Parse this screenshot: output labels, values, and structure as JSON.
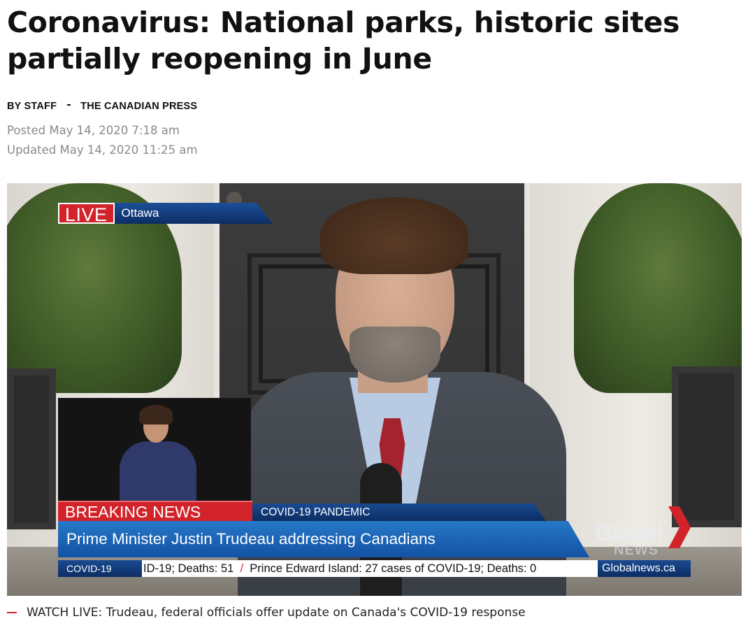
{
  "article": {
    "headline": "Coronavirus: National parks, historic sites partially reopening in June",
    "byline_author": "BY STAFF",
    "byline_source": "THE CANADIAN PRESS",
    "posted": "Posted May 14, 2020 7:18 am",
    "updated": "Updated May 14, 2020 11:25 am"
  },
  "video": {
    "live_label": "LIVE",
    "live_location": "Ottawa",
    "breaking_label": "BREAKING NEWS",
    "topic": "COVID-19 PANDEMIC",
    "headline": "Prime Minister Justin Trudeau addressing Canadians",
    "ticker_label": "COVID-19",
    "ticker_part1": "ID-19; Deaths: 51",
    "ticker_part2": "Prince Edward Island: 27 cases of COVID-19; Deaths: 0",
    "site": "Globalnews.ca",
    "logo_text": "Global",
    "logo_sub": "NEWS",
    "caption": "WATCH LIVE: Trudeau, federal officials offer update on Canada's COVID-19 response"
  },
  "colors": {
    "accent_red": "#d2232a",
    "tv_blue": "#1352a4"
  }
}
